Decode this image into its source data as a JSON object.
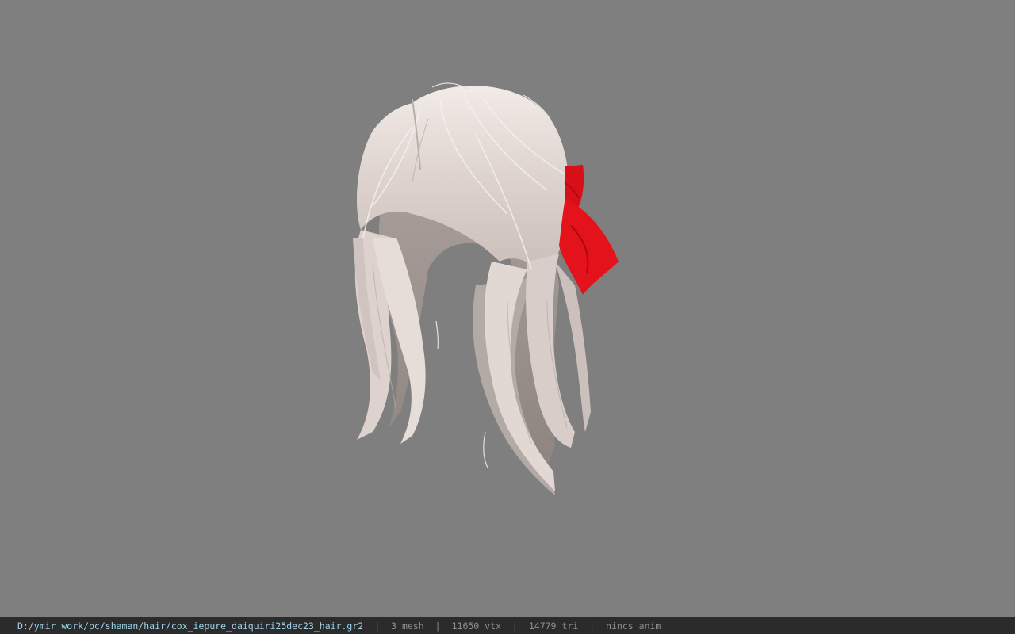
{
  "viewport": {
    "background_color": "#7f7f7f",
    "model": {
      "hair_color": "#e8ddd8",
      "bow_color": "#e3121b"
    }
  },
  "statusbar": {
    "background_color": "#2b2b2b",
    "file_path": "D:/ymir work/pc/shaman/hair/cox_iepure_daiquiri25dec23_hair.gr2",
    "separator": "|",
    "mesh_count": "3 mesh",
    "vertex_count": "11650 vtx",
    "triangle_count": "14779 tri",
    "anim_status": "nincs anim"
  }
}
